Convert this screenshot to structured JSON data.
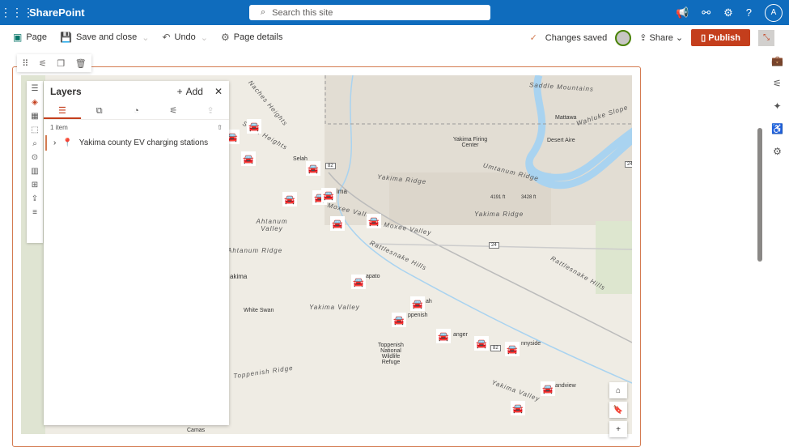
{
  "app": {
    "name": "SharePoint",
    "search_placeholder": "Search this site",
    "avatar": "A"
  },
  "cmdbar": {
    "page": "Page",
    "save": "Save and close",
    "undo": "Undo",
    "details": "Page details",
    "saved": "Changes saved",
    "share": "Share",
    "publish": "Publish"
  },
  "layers": {
    "title": "Layers",
    "add": "Add",
    "count": "1 item",
    "item": "Yakima county EV charging stations"
  },
  "map": {
    "labels": [
      "Saddle Mountains",
      "Wahluke Slope",
      "Yakima Firing Center",
      "Umtanum Ridge",
      "Yakima Ridge",
      "Yakima Ridge",
      "Moxee Valley",
      "Moxee Valley",
      "Ahtanum Valley",
      "Ahtanum Ridge",
      "Rattlesnake Hills",
      "Rattlesnake Hills",
      "Yakima Valley",
      "Yakima Valley",
      "Toppenish Ridge",
      "Selah Heights",
      "Naches Heights"
    ],
    "towns": [
      "Mattawa",
      "Desert Aire",
      "Selah",
      "ima",
      "White Swan",
      "Toppenish National Wildlife Refuge",
      "Camas",
      "apato",
      "ah",
      "ppenish",
      "anger",
      "nnyside",
      "andview",
      "4191 ft",
      "3428 ft",
      "akima"
    ],
    "shields": [
      "82",
      "24",
      "24",
      "82"
    ]
  },
  "colors": {
    "brand": "#0f6cbd",
    "accent": "#c43e1c",
    "water": "#a9d3f0"
  }
}
